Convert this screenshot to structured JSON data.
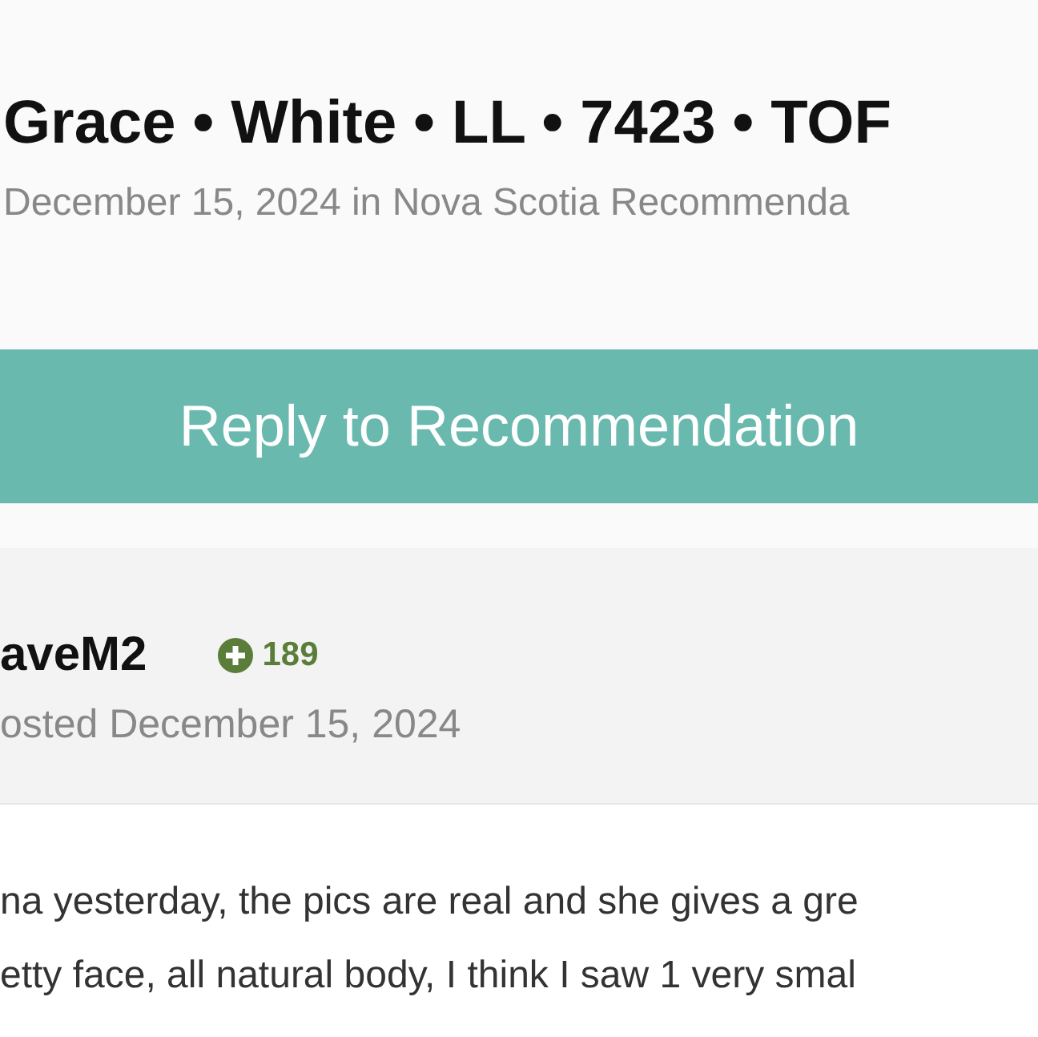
{
  "topic": {
    "title": "Grace • White • LL • 7423 • TOF",
    "meta": "December 15, 2024 in Nova Scotia Recommenda"
  },
  "reply_button": "Reply to Recommendation",
  "post": {
    "author": "aveM2",
    "reputation": "189",
    "posted": "osted December 15, 2024",
    "body_lines": [
      "na yesterday, the pics are real and she gives a gre",
      "etty face, all natural body, I think I saw 1 very smal"
    ]
  }
}
